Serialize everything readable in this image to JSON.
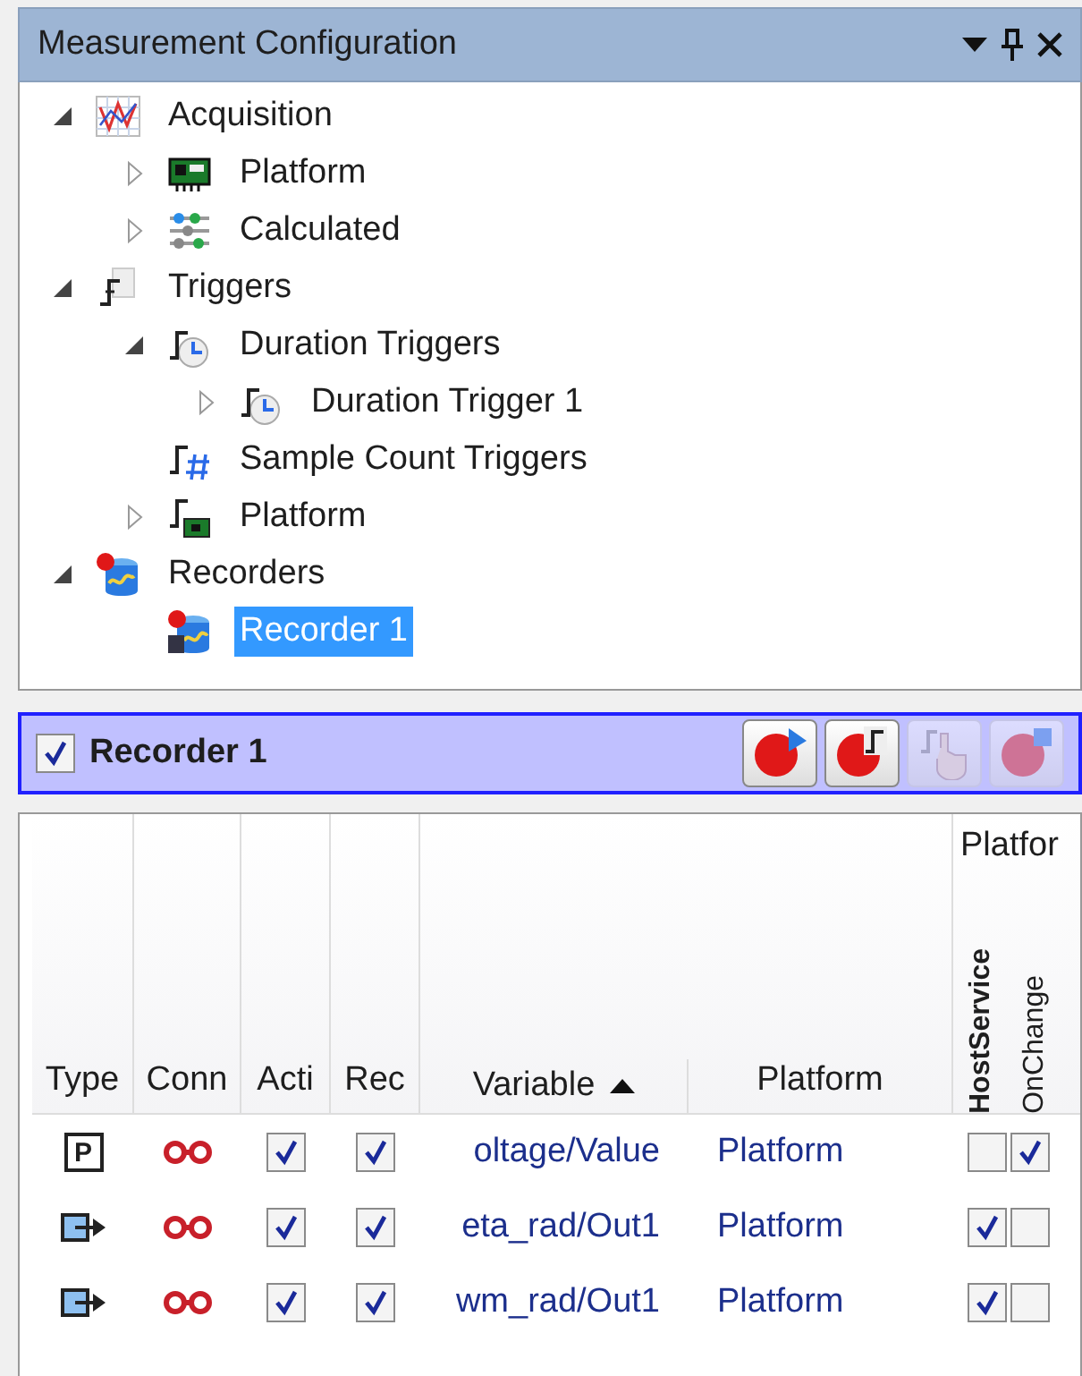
{
  "panel": {
    "title": "Measurement Configuration"
  },
  "tree": [
    {
      "label": "Acquisition",
      "kind": "chart",
      "expanded": true,
      "selected": false,
      "children": [
        {
          "label": "Platform",
          "kind": "board",
          "expanded": false,
          "selected": false
        },
        {
          "label": "Calculated",
          "kind": "sliders",
          "expanded": false,
          "selected": false
        }
      ]
    },
    {
      "label": "Triggers",
      "kind": "trigger",
      "expanded": true,
      "selected": false,
      "children": [
        {
          "label": "Duration Triggers",
          "kind": "duration",
          "expanded": true,
          "selected": false,
          "children": [
            {
              "label": "Duration Trigger 1",
              "kind": "duration",
              "expanded": false,
              "selected": false
            }
          ]
        },
        {
          "label": "Sample Count Triggers",
          "kind": "count",
          "selected": false
        },
        {
          "label": "Platform",
          "kind": "platform-trigger",
          "expanded": false,
          "selected": false
        }
      ]
    },
    {
      "label": "Recorders",
      "kind": "recorders",
      "expanded": true,
      "selected": false,
      "children": [
        {
          "label": "Recorder 1",
          "kind": "recorder",
          "selected": true
        }
      ]
    }
  ],
  "recorder": {
    "title": "Recorder 1",
    "checked": true,
    "toolbar": [
      {
        "kind": "start",
        "disabled": false
      },
      {
        "kind": "trigger",
        "disabled": false
      },
      {
        "kind": "manual",
        "disabled": true
      },
      {
        "kind": "stop",
        "disabled": true
      }
    ]
  },
  "table": {
    "columns": [
      "Type",
      "Conn",
      "Acti",
      "Rec",
      "Variable",
      "Platform"
    ],
    "group": {
      "label": "Platfor",
      "columns": [
        {
          "label": "HostService",
          "bold": true
        },
        {
          "label": "OnChange",
          "bold": false
        }
      ]
    },
    "rows": [
      {
        "kind": "parameter",
        "type_label": "P",
        "active": true,
        "record": true,
        "variable": "oltage/Value",
        "platform": "Platform",
        "host_service": false,
        "on_change": true
      },
      {
        "kind": "signal",
        "active": true,
        "record": true,
        "variable": "eta_rad/Out1",
        "platform": "Platform",
        "host_service": true,
        "on_change": false
      },
      {
        "kind": "signal",
        "active": true,
        "record": true,
        "variable": "wm_rad/Out1",
        "platform": "Platform",
        "host_service": true,
        "on_change": false
      }
    ]
  }
}
